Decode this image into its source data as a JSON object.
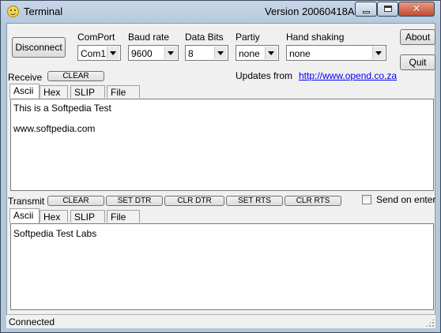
{
  "window": {
    "title": "Terminal",
    "version": "Version 20060418A",
    "close_glyph": "✕"
  },
  "connection": {
    "disconnect_label": "Disconnect",
    "comport": {
      "label": "ComPort",
      "value": "Com1"
    },
    "baud": {
      "label": "Baud rate",
      "value": "9600"
    },
    "databits": {
      "label": "Data Bits",
      "value": "8"
    },
    "parity": {
      "label": "Partiy",
      "value": "none"
    },
    "handshaking": {
      "label": "Hand shaking",
      "value": "none"
    },
    "about_label": "About",
    "quit_label": "Quit",
    "updates_label": "Updates from",
    "updates_link": "http://www.opend.co.za"
  },
  "receive": {
    "label": "Receive",
    "clear_label": "CLEAR",
    "tabs": [
      "Ascii",
      "Hex",
      "SLIP",
      "File"
    ],
    "active_tab": "Ascii",
    "lines": [
      "This is a Softpedia Test",
      "",
      "www.softpedia.com"
    ]
  },
  "transmit": {
    "label": "Transmit",
    "buttons": {
      "clear": "CLEAR",
      "set_dtr": "SET DTR",
      "clr_dtr": "CLR DTR",
      "set_rts": "SET RTS",
      "clr_rts": "CLR RTS"
    },
    "send_on_enter_label": "Send on enter",
    "send_on_enter_checked": false,
    "tabs": [
      "Ascii",
      "Hex",
      "SLIP",
      "File"
    ],
    "active_tab": "Ascii",
    "lines": [
      "Softpedia Test Labs"
    ]
  },
  "status": {
    "text": "Connected"
  }
}
